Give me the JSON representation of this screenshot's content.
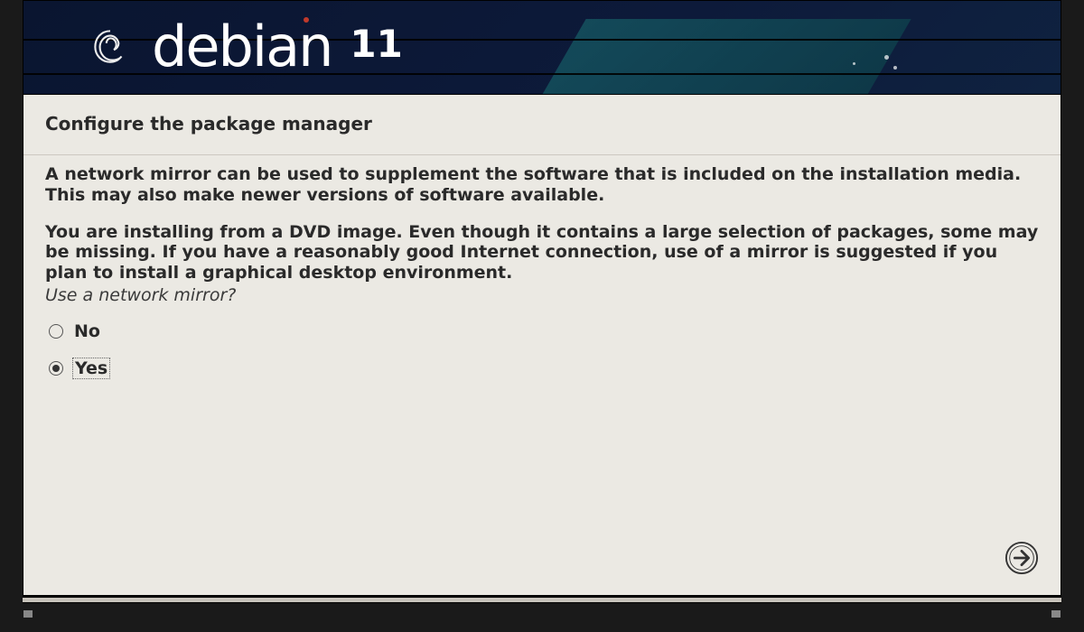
{
  "header": {
    "brand": "debian",
    "version": "11"
  },
  "page": {
    "title": "Configure the package manager",
    "paragraph1": "A network mirror can be used to supplement the software that is included on the installation media. This may also make newer versions of software available.",
    "paragraph2": "You are installing from a DVD image. Even though it contains a large selection of packages, some may be missing. If you have a reasonably good Internet connection, use of a mirror is suggested if you plan to install a graphical desktop environment.",
    "question": "Use a network mirror?"
  },
  "options": {
    "no": "No",
    "yes": "Yes",
    "selected": "yes"
  }
}
